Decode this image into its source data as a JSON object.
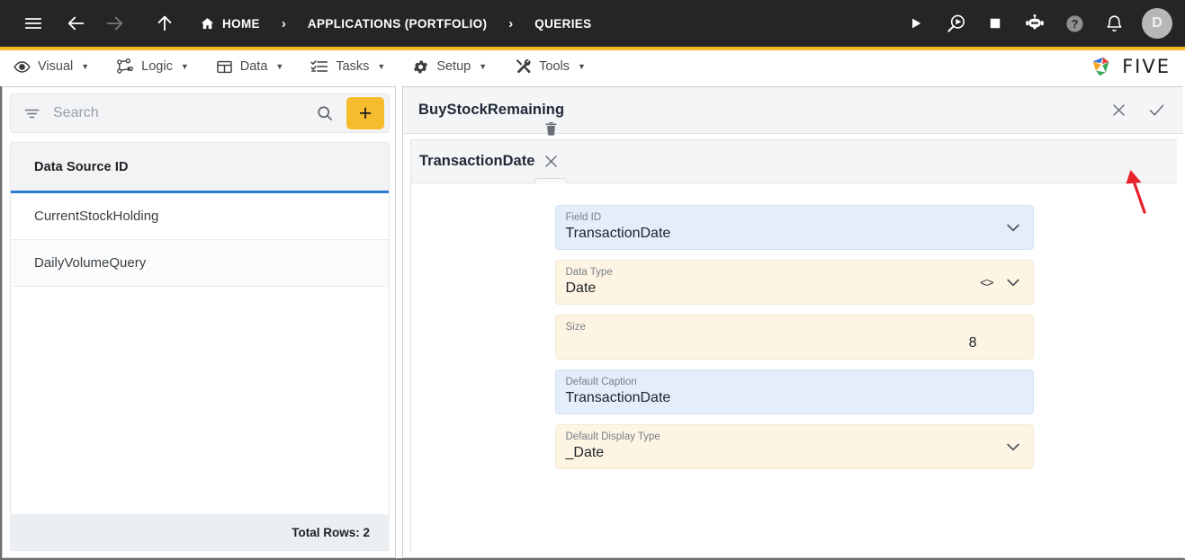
{
  "topbar": {
    "icons": {
      "menu": "hamburger-icon",
      "back": "arrow-back-icon",
      "forward": "arrow-forward-icon",
      "up": "arrow-up-icon",
      "run": "play-icon",
      "debug": "debug-search-icon",
      "stop": "stop-icon",
      "assistant": "robot-icon",
      "help": "help-icon",
      "notifications": "bell-icon"
    },
    "breadcrumbs": [
      {
        "label": "HOME",
        "icon": "home-icon"
      },
      {
        "label": "APPLICATIONS (PORTFOLIO)"
      },
      {
        "label": "QUERIES"
      }
    ],
    "separator": "›",
    "avatar_initial": "D"
  },
  "menubar": {
    "items": [
      {
        "label": "Visual",
        "icon": "eye-icon"
      },
      {
        "label": "Logic",
        "icon": "nodes-icon"
      },
      {
        "label": "Data",
        "icon": "grid-icon"
      },
      {
        "label": "Tasks",
        "icon": "checklist-icon"
      },
      {
        "label": "Setup",
        "icon": "gear-icon"
      },
      {
        "label": "Tools",
        "icon": "tools-icon"
      }
    ],
    "caret": "▼",
    "brand": "FIVE"
  },
  "sidebar": {
    "search": {
      "placeholder": "Search",
      "value": ""
    },
    "add_label": "+",
    "grid": {
      "column_header": "Data Source ID",
      "rows": [
        {
          "name": "CurrentStockHolding"
        },
        {
          "name": "DailyVolumeQuery"
        }
      ]
    },
    "footer": "Total Rows: 2"
  },
  "main": {
    "record_title": "BuyStockRemaining",
    "record_actions": {
      "close": "✕",
      "save": "✓"
    },
    "field_title": "TransactionDate",
    "field_actions": {
      "delete": "trash-icon",
      "close": "✕",
      "save": "✓"
    },
    "fields": [
      {
        "label": "Field ID",
        "value": "TransactionDate",
        "style": "blue",
        "dropdown": true,
        "code": false,
        "align": "left"
      },
      {
        "label": "Data Type",
        "value": "Date",
        "style": "cream",
        "dropdown": true,
        "code": true,
        "align": "left"
      },
      {
        "label": "Size",
        "value": "8",
        "style": "cream",
        "dropdown": false,
        "code": false,
        "align": "right"
      },
      {
        "label": "Default Caption",
        "value": "TransactionDate",
        "style": "blue",
        "dropdown": false,
        "code": false,
        "align": "left"
      },
      {
        "label": "Default Display Type",
        "value": "_Date",
        "style": "cream",
        "dropdown": true,
        "code": false,
        "align": "left"
      }
    ]
  },
  "colors": {
    "topbar_bg": "#252526",
    "accent_yellow": "#f5b825",
    "add_button": "#f7bb2e",
    "grid_underline": "#2b7cd3",
    "field_blue": "#e4eefb",
    "field_cream": "#fdf4e4",
    "annotation_red": "#e8202a"
  }
}
